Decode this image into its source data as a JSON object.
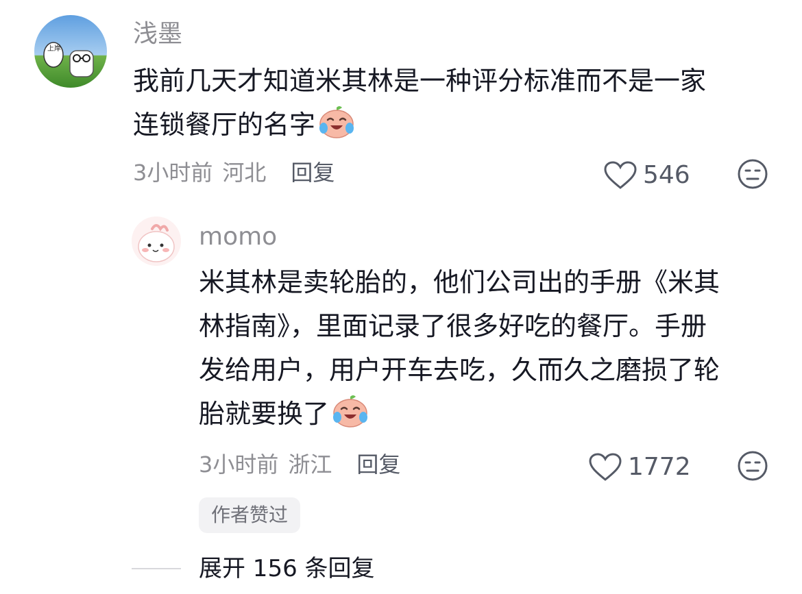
{
  "comment": {
    "username": "浅墨",
    "avatar_text": "上岸",
    "text_line1": "我前几天才知道米其林是一种评分标准而不是一家",
    "text_line2": "连锁餐厅的名字",
    "time": "3小时前",
    "location": "河北",
    "reply_label": "回复",
    "likes": "546",
    "emoji_icon": "laugh-cry-emoji-icon"
  },
  "reply": {
    "username": "momo",
    "text_line1": "米其林是卖轮胎的，他们公司出的手册《米其",
    "text_line2": "林指南》，里面记录了很多好吃的餐厅。手册",
    "text_line3": "发给用户，用户开车去吃，久而久之磨损了轮",
    "text_line4": "胎就要换了",
    "time": "3小时前",
    "location": "浙江",
    "reply_label": "回复",
    "likes": "1772",
    "author_badge": "作者赞过"
  },
  "expand": {
    "label": "展开 156 条回复"
  },
  "colors": {
    "text_primary": "#161823",
    "text_secondary": "#8e8e93",
    "badge_bg": "#f2f2f4"
  }
}
